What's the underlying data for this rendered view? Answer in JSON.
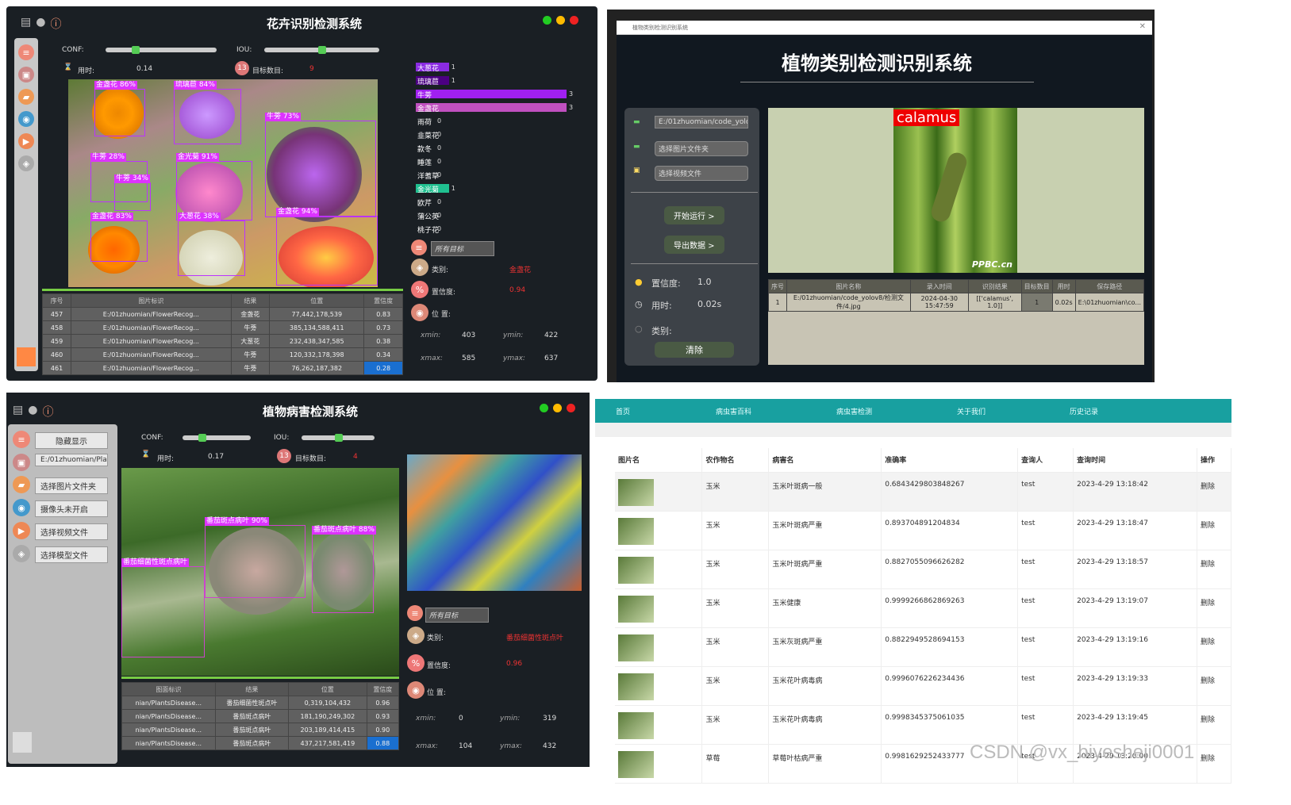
{
  "p1": {
    "title": "花卉识别检测系统",
    "conf_label": "CONF:",
    "iou_label": "IOU:",
    "time_label": "用时:",
    "time_value": "0.14",
    "count_label": "目标数目:",
    "count_value": "9",
    "detections": [
      {
        "label": "金盏花 86%"
      },
      {
        "label": "琉璃苣 84%"
      },
      {
        "label": "牛蒡 73%"
      },
      {
        "label": "牛蒡 28%"
      },
      {
        "label": "金光菊 91%"
      },
      {
        "label": "牛蒡 34%"
      },
      {
        "label": "金盏花 83%"
      },
      {
        "label": "大葱花 38%"
      },
      {
        "label": "金盏花 94%"
      }
    ],
    "bars": [
      {
        "name": "大葱花",
        "count": "1",
        "frac": 0.22,
        "color": "#8a2be2"
      },
      {
        "name": "琉璃苣",
        "count": "1",
        "frac": 0.22,
        "color": "#4b0082"
      },
      {
        "name": "牛蒡",
        "count": "3",
        "frac": 1.0,
        "color": "#a020f0"
      },
      {
        "name": "金盏花",
        "count": "3",
        "frac": 1.0,
        "color": "#c050c0"
      },
      {
        "name": "雨荷",
        "count": "0",
        "frac": 0,
        "color": "#888"
      },
      {
        "name": "韭菜花",
        "count": "0",
        "frac": 0,
        "color": "#888"
      },
      {
        "name": "款冬",
        "count": "0",
        "frac": 0,
        "color": "#888"
      },
      {
        "name": "睡莲",
        "count": "0",
        "frac": 0,
        "color": "#888"
      },
      {
        "name": "洋蓍草",
        "count": "0",
        "frac": 0,
        "color": "#888"
      },
      {
        "name": "金光菊",
        "count": "1",
        "frac": 0.22,
        "color": "#20c090"
      },
      {
        "name": "欧芹",
        "count": "0",
        "frac": 0,
        "color": "#888"
      },
      {
        "name": "蒲公英",
        "count": "0",
        "frac": 0,
        "color": "#888"
      },
      {
        "name": "桃子花",
        "count": "0",
        "frac": 0,
        "color": "#888"
      }
    ],
    "target_select": "所有目标",
    "class_label": "类别:",
    "class_value": "金盏花",
    "conf2_label": "置信度:",
    "conf2_value": "0.94",
    "pos_label": "位 置:",
    "xmin_label": "xmin:",
    "xmin": "403",
    "ymin_label": "ymin:",
    "ymin": "422",
    "xmax_label": "xmax:",
    "xmax": "585",
    "ymax_label": "ymax:",
    "ymax": "637",
    "table_headers": [
      "序号",
      "图片标识",
      "结果",
      "位置",
      "置信度"
    ],
    "rows": [
      [
        "457",
        "E:/01zhuomian/FlowerRecog...",
        "金盏花",
        "77,442,178,539",
        "0.83"
      ],
      [
        "458",
        "E:/01zhuomian/FlowerRecog...",
        "牛蒡",
        "385,134,588,411",
        "0.73"
      ],
      [
        "459",
        "E:/01zhuomian/FlowerRecog...",
        "大葱花",
        "232,438,347,585",
        "0.38"
      ],
      [
        "460",
        "E:/01zhuomian/FlowerRecog...",
        "牛蒡",
        "120,332,178,398",
        "0.34"
      ],
      [
        "461",
        "E:/01zhuomian/FlowerRecog...",
        "牛蒡",
        "76,262,187,382",
        "0.28"
      ]
    ]
  },
  "p2": {
    "window_title": "植物类别检测识别系统",
    "title": "植物类别检测识别系统",
    "path_field": "E:/01zhuomian/code_yolo",
    "select_folder": "选择图片文件夹",
    "select_video": "选择视频文件",
    "run_btn": "开始运行 >",
    "export_btn": "导出数据 >",
    "conf_label": "置信度:",
    "conf_value": "1.0",
    "time_label": "用时:",
    "time_value": "0.02s",
    "class_label": "类别:",
    "clear_btn": "清除",
    "detect_label": "calamus",
    "watermark": "PPBC.cn",
    "table_headers": [
      "序号",
      "图片名称",
      "录入时间",
      "识别结果",
      "目标数目",
      "用时",
      "保存路径"
    ],
    "row": [
      "1",
      "E:/01zhuomian/code_yolov8/检测文件/4.jpg",
      "2024-04-30 15:47:59",
      "[['calamus', 1.0]]",
      "1",
      "0.02s",
      "E:\\01zhuomian\\co..."
    ]
  },
  "p3": {
    "title": "植物病害检测系统",
    "hide_btn": "隐藏显示",
    "path_field": "E:/01zhuomian/Plants",
    "select_folder": "选择图片文件夹",
    "camera": "摄像头未开启",
    "select_video": "选择视频文件",
    "select_model": "选择模型文件",
    "conf_label": "CONF:",
    "iou_label": "IOU:",
    "time_label": "用时:",
    "time_value": "0.17",
    "count_label": "目标数目:",
    "count_value": "4",
    "detections": [
      {
        "label": "番茄斑点病叶 90%"
      },
      {
        "label": "番茄斑点病叶 88%"
      },
      {
        "label": "番茄细菌性斑点病叶"
      }
    ],
    "target_select": "所有目标",
    "class_label": "类别:",
    "class_value": "番茄细菌性斑点叶",
    "conf2_label": "置信度:",
    "conf2_value": "0.96",
    "pos_label": "位 置:",
    "xmin_label": "xmin:",
    "xmin": "0",
    "ymin_label": "ymin:",
    "ymin": "319",
    "xmax_label": "xmax:",
    "xmax": "104",
    "ymax_label": "ymax:",
    "ymax": "432",
    "table_headers": [
      "图面标识",
      "结果",
      "位置",
      "置信度"
    ],
    "rows": [
      [
        "nian/PlantsDisease...",
        "番茄细菌性斑点叶",
        "0,319,104,432",
        "0.96"
      ],
      [
        "nian/PlantsDisease...",
        "番茄斑点病叶",
        "181,190,249,302",
        "0.93"
      ],
      [
        "nian/PlantsDisease...",
        "番茄斑点病叶",
        "203,189,414,415",
        "0.90"
      ],
      [
        "nian/PlantsDisease...",
        "番茄斑点病叶",
        "437,217,581,419",
        "0.88"
      ]
    ]
  },
  "p4": {
    "nav": [
      "首页",
      "病虫害百科",
      "病虫害检测",
      "关于我们",
      "历史记录"
    ],
    "headers": [
      "图片名",
      "农作物名",
      "病害名",
      "准确率",
      "查询人",
      "查询时间",
      "操作"
    ],
    "rows": [
      [
        "玉米",
        "玉米叶斑病一般",
        "0.6843429803848267",
        "test",
        "2023-4-29 13:18:42",
        "删除"
      ],
      [
        "玉米",
        "玉米叶斑病严重",
        "0.893704891204834",
        "test",
        "2023-4-29 13:18:47",
        "删除"
      ],
      [
        "玉米",
        "玉米叶斑病严重",
        "0.8827055096626282",
        "test",
        "2023-4-29 13:18:57",
        "删除"
      ],
      [
        "玉米",
        "玉米健康",
        "0.9999266862869263",
        "test",
        "2023-4-29 13:19:07",
        "删除"
      ],
      [
        "玉米",
        "玉米灰斑病严重",
        "0.8822949528694153",
        "test",
        "2023-4-29 13:19:16",
        "删除"
      ],
      [
        "玉米",
        "玉米花叶病毒病",
        "0.9996076226234436",
        "test",
        "2023-4-29 13:19:33",
        "删除"
      ],
      [
        "玉米",
        "玉米花叶病毒病",
        "0.9998345375061035",
        "test",
        "2023-4-29 13:19:45",
        "删除"
      ],
      [
        "草莓",
        "草莓叶枯病严重",
        "0.9981629252433777",
        "test",
        "2023-4-29 13:20:00",
        "删除"
      ]
    ],
    "watermark": "CSDN @vx_biyesheji0001"
  }
}
